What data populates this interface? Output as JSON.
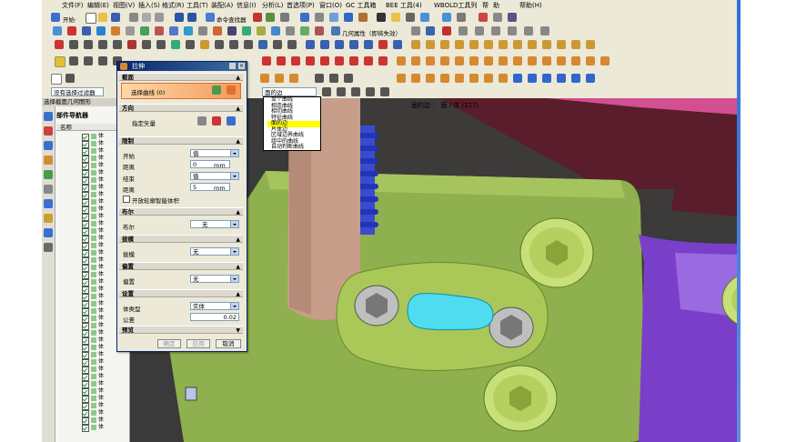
{
  "menubar": {
    "items": [
      "文件(F)",
      "编辑(E)",
      "视图(V)",
      "插入(S)",
      "格式(R)",
      "工具(T)",
      "装配(A)",
      "信息(I)",
      "分析(L)",
      "首选项(P)",
      "窗口(O)",
      "GC 工具箱",
      "BEE 工具(4)",
      "WBOLD工具列",
      "帮",
      "助",
      "帮助(H)"
    ]
  },
  "toolbar": {
    "start_label": "开始·",
    "cmd_finder": "命令查找器",
    "geo_link": "几何属性（即将失效）",
    "filter_label": "没有选择过滤器",
    "face_label": "面的边",
    "curve_rule": "面的边"
  },
  "nav": {
    "header": "选择截面几何图形",
    "title": "部件导航器",
    "col_name": "名称",
    "rows": [
      "体",
      "体",
      "体",
      "体",
      "体",
      "体",
      "体",
      "体",
      "体",
      "体",
      "体",
      "体",
      "体",
      "体",
      "体",
      "体",
      "体",
      "体",
      "体",
      "体",
      "体",
      "体",
      "体",
      "体",
      "体",
      "体",
      "体",
      "体",
      "体",
      "体",
      "体",
      "体",
      "体",
      "体",
      "体",
      "体",
      "体",
      "体",
      "体",
      "体",
      "体"
    ]
  },
  "dialog": {
    "title": "拉伸",
    "sec_section": "截面",
    "select_curve": "选择曲线 (0)",
    "sec_direction": "方向",
    "specify_vector": "指定矢量",
    "sec_limits": "限制",
    "start_label": "开始",
    "start_type": "值",
    "distance_label": "距离",
    "start_distance": "0",
    "end_label": "结束",
    "end_type": "值",
    "end_distance": "5",
    "unit": "mm",
    "open_profile": "开放轮廓智能体积",
    "sec_boolean": "布尔",
    "boolean_label": "布尔",
    "boolean_value": "无",
    "sec_draft": "拔模",
    "draft_label": "拔模",
    "draft_value": "无",
    "sec_offset": "偏置",
    "offset_label": "偏置",
    "offset_value": "无",
    "sec_settings": "设置",
    "body_type_label": "体类型",
    "body_type_value": "实体",
    "tolerance_label": "公差",
    "tolerance_value": "0.02",
    "sec_preview": "预览",
    "ok": "确定",
    "apply": "应用",
    "cancel": "取消"
  },
  "popup": {
    "items": [
      "单个曲线",
      "相连曲线",
      "相切曲线",
      "特征曲线",
      "面的边",
      "片体边",
      "区域边界曲线",
      "组中的曲线",
      "自动判断曲线"
    ],
    "highlight_index": 4
  },
  "status": {
    "text": "面的边 ： 面 / 体 (227)"
  },
  "colors": {
    "plate": "#8fb04e",
    "highlight": "#4fdcef",
    "accent_purple": "#7a3fc9",
    "pink_block": "#d24f90",
    "maroon": "#5a1d2b"
  }
}
